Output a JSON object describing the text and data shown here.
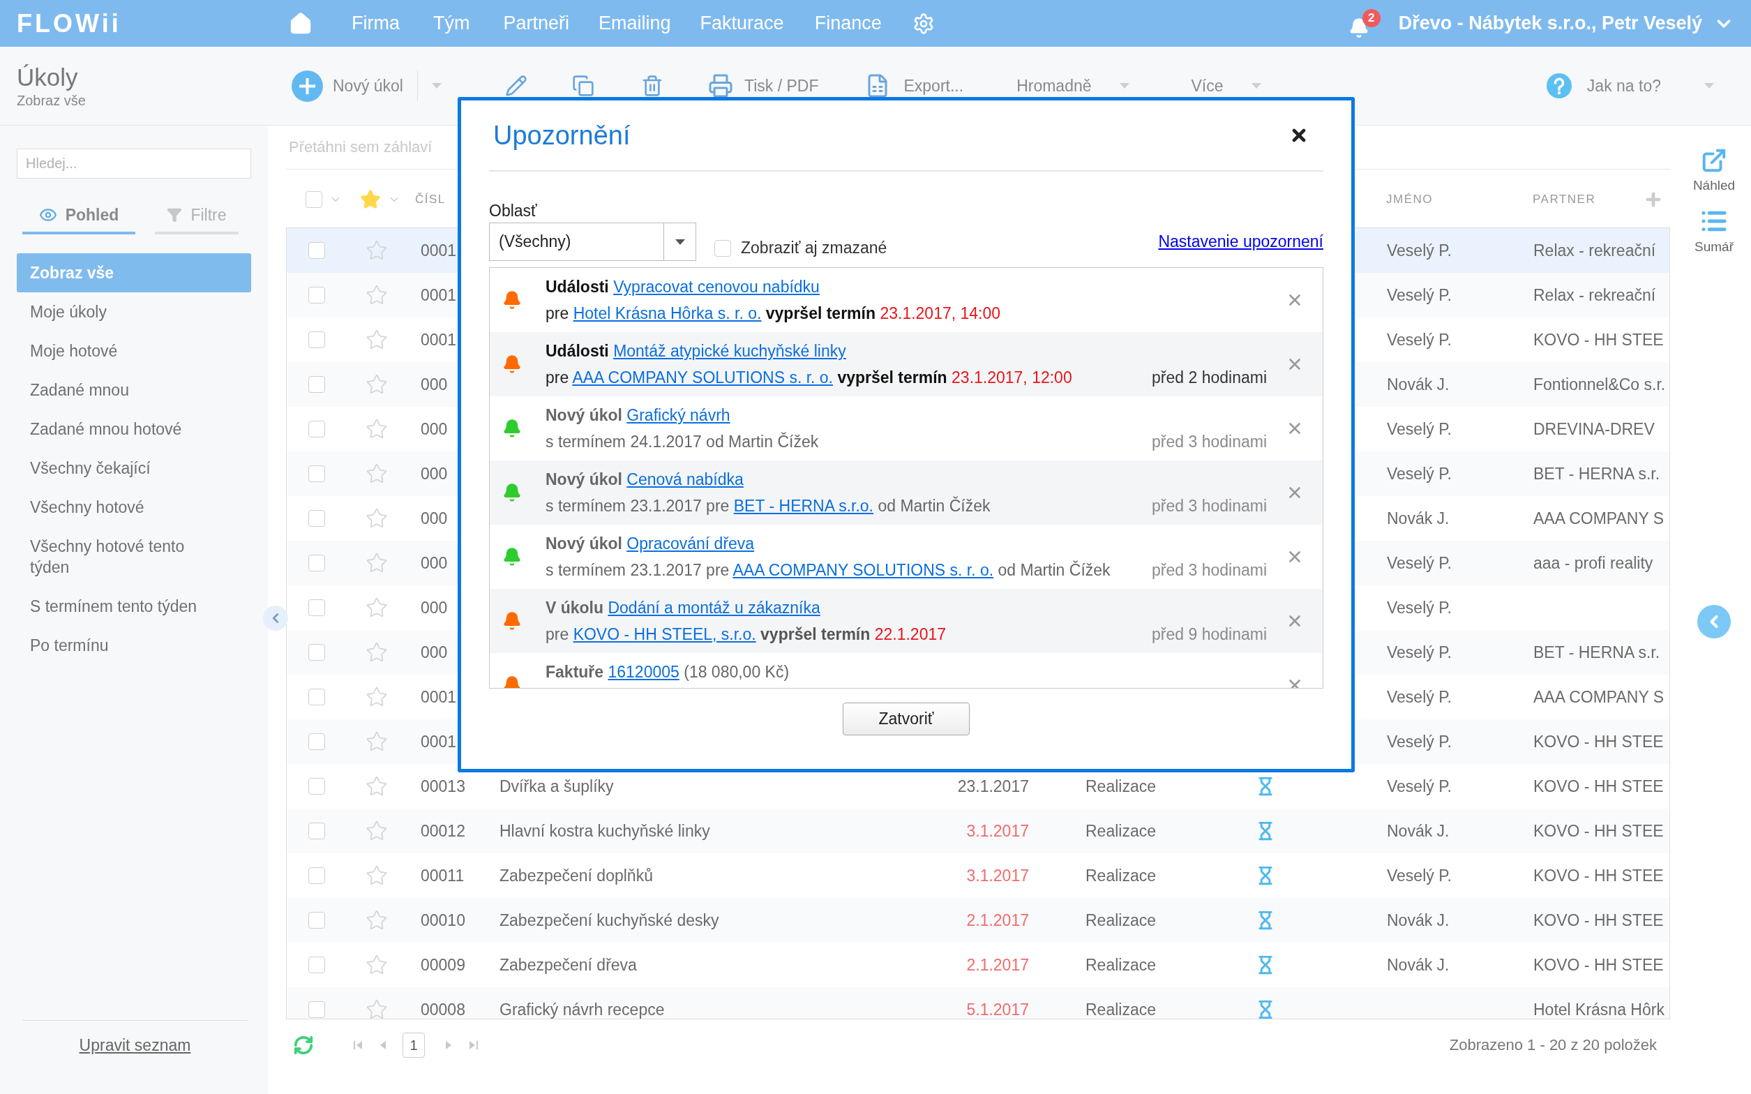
{
  "app": {
    "logo": "FLOWii",
    "nav": [
      "Firma",
      "Tým",
      "Partneři",
      "Emailing",
      "Fakturace",
      "Finance"
    ],
    "notification_count": "2",
    "account": "Dřevo - Nábytek s.r.o., Petr Veselý"
  },
  "page": {
    "title": "Úkoly",
    "subtitle": "Zobraz vše"
  },
  "toolbar": {
    "new_task": "Nový úkol",
    "print": "Tisk / PDF",
    "export": "Export...",
    "bulk": "Hromadně",
    "more": "Více",
    "help": "Jak na to?"
  },
  "sidebar": {
    "search_placeholder": "Hledej...",
    "tabs": [
      {
        "label": "Pohled",
        "selected": true
      },
      {
        "label": "Filtre",
        "selected": false
      }
    ],
    "items": [
      {
        "label": "Zobraz vše",
        "selected": true
      },
      {
        "label": "Moje úkoly",
        "selected": false
      },
      {
        "label": "Moje hotové",
        "selected": false
      },
      {
        "label": "Zadané mnou",
        "selected": false
      },
      {
        "label": "Zadané mnou hotové",
        "selected": false
      },
      {
        "label": "Všechny čekající",
        "selected": false
      },
      {
        "label": "Všechny hotové",
        "selected": false
      },
      {
        "label": "Všechny hotové tento týden",
        "selected": false
      },
      {
        "label": "S termínem tento týden",
        "selected": false
      },
      {
        "label": "Po termínu",
        "selected": false
      }
    ],
    "edit_link": "Upravit seznam"
  },
  "grid": {
    "group_hint": "Přetáhni sem záhlaví",
    "select_all_checked": false,
    "header": {
      "number": "ČÍSL",
      "name": "JMÉNO",
      "partner": "PARTNER"
    },
    "rows": [
      {
        "number": "0001",
        "name": "Veselý P.",
        "partner": "Relax - rekreační",
        "checked": false,
        "selected": true
      },
      {
        "number": "0001",
        "name": "Veselý P.",
        "partner": "Relax - rekreační",
        "checked": false,
        "selected": false
      },
      {
        "number": "0001",
        "name": "Veselý P.",
        "partner": "KOVO - HH STEE",
        "checked": false,
        "selected": false
      },
      {
        "number": "000",
        "name": "Novák J.",
        "partner": "Fontionnel&Co s.r.",
        "checked": false,
        "selected": false
      },
      {
        "number": "000",
        "name": "Veselý P.",
        "partner": "DREVINA-DREV",
        "checked": false,
        "selected": false
      },
      {
        "number": "000",
        "name": "Veselý P.",
        "partner": "BET - HERNA s.r.",
        "checked": false,
        "selected": false
      },
      {
        "number": "000",
        "name": "Novák J.",
        "partner": "AAA COMPANY S",
        "checked": false,
        "selected": false
      },
      {
        "number": "000",
        "name": "Veselý P.",
        "partner": "aaa - profi reality",
        "checked": false,
        "selected": false
      },
      {
        "number": "000",
        "name": "Veselý P.",
        "checked": false,
        "selected": false
      },
      {
        "number": "000",
        "name": "Veselý P.",
        "partner": "BET - HERNA s.r.",
        "checked": false,
        "selected": false
      },
      {
        "number": "0001",
        "name": "Veselý P.",
        "partner": "AAA COMPANY S",
        "checked": false,
        "selected": false
      },
      {
        "number": "0001",
        "name": "Veselý P.",
        "partner": "KOVO - HH STEE",
        "checked": false,
        "selected": false
      },
      {
        "number": "00013",
        "title": "Dvířka a šuplíky",
        "date": "23.1.2017",
        "overdue": false,
        "status": "Realizace",
        "name": "Veselý P.",
        "partner": "KOVO - HH STEE",
        "checked": false,
        "selected": false
      },
      {
        "number": "00012",
        "title": "Hlavní kostra kuchyňské linky",
        "date": "3.1.2017",
        "overdue": true,
        "status": "Realizace",
        "name": "Novák J.",
        "partner": "KOVO - HH STEE",
        "checked": false,
        "selected": false
      },
      {
        "number": "00011",
        "title": "Zabezpečení doplňků",
        "date": "3.1.2017",
        "overdue": true,
        "status": "Realizace",
        "name": "Veselý P.",
        "partner": "KOVO - HH STEE",
        "checked": false,
        "selected": false
      },
      {
        "number": "00010",
        "title": "Zabezpečení kuchyňské desky",
        "date": "2.1.2017",
        "overdue": true,
        "status": "Realizace",
        "name": "Novák J.",
        "partner": "KOVO - HH STEE",
        "checked": false,
        "selected": false
      },
      {
        "number": "00009",
        "title": "Zabezpečení dřeva",
        "date": "2.1.2017",
        "overdue": true,
        "status": "Realizace",
        "name": "Novák J.",
        "partner": "KOVO - HH STEE",
        "checked": false,
        "selected": false
      },
      {
        "number": "00008",
        "title": "Grafický návrh recepce",
        "date": "5.1.2017",
        "overdue": true,
        "status": "Realizace",
        "partner": "Hotel Krásna Hôrk",
        "checked": false,
        "selected": false
      }
    ],
    "page": "1",
    "summary": "Zobrazeno 1 - 20 z 20 položek"
  },
  "right_panel": {
    "preview": "Náhled",
    "summary": "Sumář"
  },
  "modal": {
    "title": "Upozornění",
    "area_label": "Oblasť",
    "area_value": "(Všechny)",
    "show_deleted": {
      "label": "Zobraziť aj zmazané",
      "checked": false
    },
    "settings_link": "Nastavenie upozornení",
    "notifications": [
      {
        "color": "#ff6a00",
        "read": false,
        "line1": [
          {
            "kind": "lead",
            "text": "Události"
          },
          {
            "kind": "link",
            "text": "Vypracovat cenovou nabídku"
          }
        ],
        "line2": [
          {
            "kind": "text",
            "text": "pre"
          },
          {
            "kind": "link",
            "text": "Hotel Krásna Hôrka s. r. o."
          },
          {
            "kind": "strong",
            "text": "vypršel termín"
          },
          {
            "kind": "date",
            "text": "23.1.2017, 14:00"
          }
        ]
      },
      {
        "color": "#ff6a00",
        "read": false,
        "line1": [
          {
            "kind": "lead",
            "text": "Události"
          },
          {
            "kind": "link",
            "text": "Montáž atypické kuchyňské linky"
          }
        ],
        "line2": [
          {
            "kind": "text",
            "text": "pre"
          },
          {
            "kind": "link",
            "text": "AAA COMPANY SOLUTIONS s. r. o."
          },
          {
            "kind": "strong",
            "text": "vypršel termín"
          },
          {
            "kind": "date",
            "text": "23.1.2017, 12:00"
          }
        ],
        "time": "před 2 hodinami"
      },
      {
        "color": "#2ecc2e",
        "read": true,
        "line1": [
          {
            "kind": "lead",
            "text": "Nový úkol"
          },
          {
            "kind": "link",
            "text": "Grafický návrh"
          }
        ],
        "line2": [
          {
            "kind": "text",
            "text": "s termínem 24.1.2017 od Martin Čížek"
          }
        ],
        "time": "před 3 hodinami"
      },
      {
        "color": "#2ecc2e",
        "read": true,
        "line1": [
          {
            "kind": "lead",
            "text": "Nový úkol"
          },
          {
            "kind": "link",
            "text": "Cenová nabídka"
          }
        ],
        "line2": [
          {
            "kind": "text",
            "text": "s termínem 23.1.2017 pre"
          },
          {
            "kind": "link",
            "text": "BET - HERNA s.r.o."
          },
          {
            "kind": "text",
            "text": "od Martin Čížek"
          }
        ],
        "time": "před 3 hodinami"
      },
      {
        "color": "#2ecc2e",
        "read": true,
        "line1": [
          {
            "kind": "lead",
            "text": "Nový úkol"
          },
          {
            "kind": "link",
            "text": "Opracování dřeva"
          }
        ],
        "line2": [
          {
            "kind": "text",
            "text": "s termínem 23.1.2017 pre"
          },
          {
            "kind": "link",
            "text": "AAA COMPANY SOLUTIONS s. r. o."
          },
          {
            "kind": "text",
            "text": "od Martin Čížek"
          }
        ],
        "time": "před 3 hodinami"
      },
      {
        "color": "#ff6a00",
        "read": true,
        "line1": [
          {
            "kind": "lead",
            "text": "V úkolu"
          },
          {
            "kind": "link",
            "text": "Dodání a montáž u zákazníka"
          }
        ],
        "line2": [
          {
            "kind": "text",
            "text": "pre"
          },
          {
            "kind": "link",
            "text": "KOVO - HH STEEL, s.r.o."
          },
          {
            "kind": "strong",
            "text": "vypršel termín"
          },
          {
            "kind": "date",
            "text": "22.1.2017"
          }
        ],
        "time": "před 9 hodinami"
      },
      {
        "color": "#ff6a00",
        "read": true,
        "line1": [
          {
            "kind": "lead",
            "text": "Faktuře"
          },
          {
            "kind": "link",
            "text": "16120005"
          },
          {
            "kind": "text",
            "text": "(18 080,00 Kč)"
          }
        ]
      }
    ],
    "close_button": "Zatvoriť"
  }
}
